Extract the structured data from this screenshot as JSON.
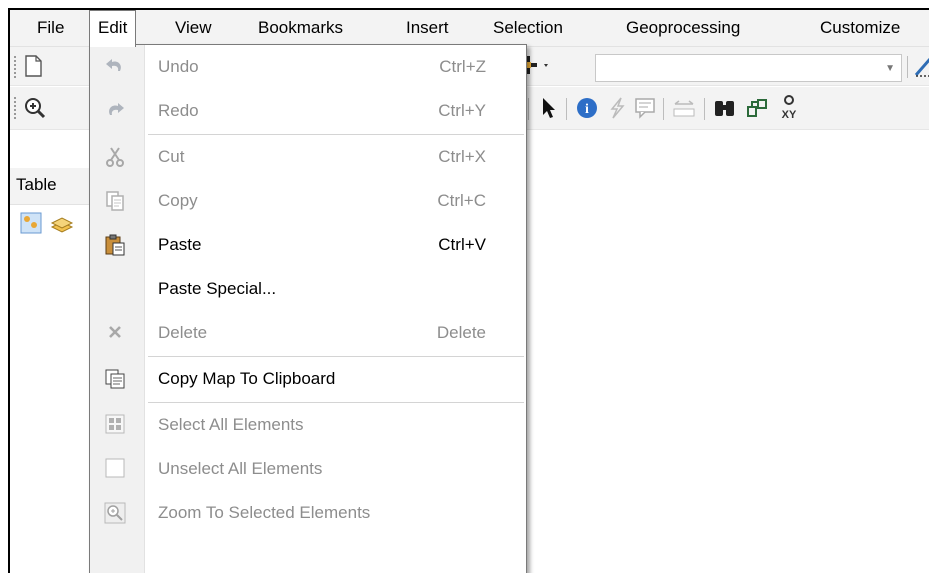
{
  "menubar": {
    "items": [
      "File",
      "Edit",
      "View",
      "Bookmarks",
      "Insert",
      "Selection",
      "Geoprocessing",
      "Customize"
    ]
  },
  "toc": {
    "title": "Table"
  },
  "edit_menu": {
    "items": [
      {
        "label": "Undo",
        "shortcut": "Ctrl+Z",
        "icon": "undo-icon",
        "enabled": false
      },
      {
        "label": "Redo",
        "shortcut": "Ctrl+Y",
        "icon": "redo-icon",
        "enabled": false
      },
      {
        "label": "Cut",
        "shortcut": "Ctrl+X",
        "icon": "scissors-icon",
        "enabled": false
      },
      {
        "label": "Copy",
        "shortcut": "Ctrl+C",
        "icon": "copy-icon",
        "enabled": false
      },
      {
        "label": "Paste",
        "shortcut": "Ctrl+V",
        "icon": "paste-icon",
        "enabled": true
      },
      {
        "label": "Paste Special...",
        "shortcut": "",
        "icon": "",
        "enabled": true
      },
      {
        "label": "Delete",
        "shortcut": "Delete",
        "icon": "delete-icon",
        "enabled": false
      },
      {
        "label": "Copy Map To Clipboard",
        "shortcut": "",
        "icon": "copy-map-icon",
        "enabled": true
      },
      {
        "label": "Select All Elements",
        "shortcut": "",
        "icon": "select-all-icon",
        "enabled": false
      },
      {
        "label": "Unselect All Elements",
        "shortcut": "",
        "icon": "unselect-all-icon",
        "enabled": false
      },
      {
        "label": "Zoom To Selected Elements",
        "shortcut": "",
        "icon": "zoom-selected-icon",
        "enabled": false
      }
    ]
  }
}
